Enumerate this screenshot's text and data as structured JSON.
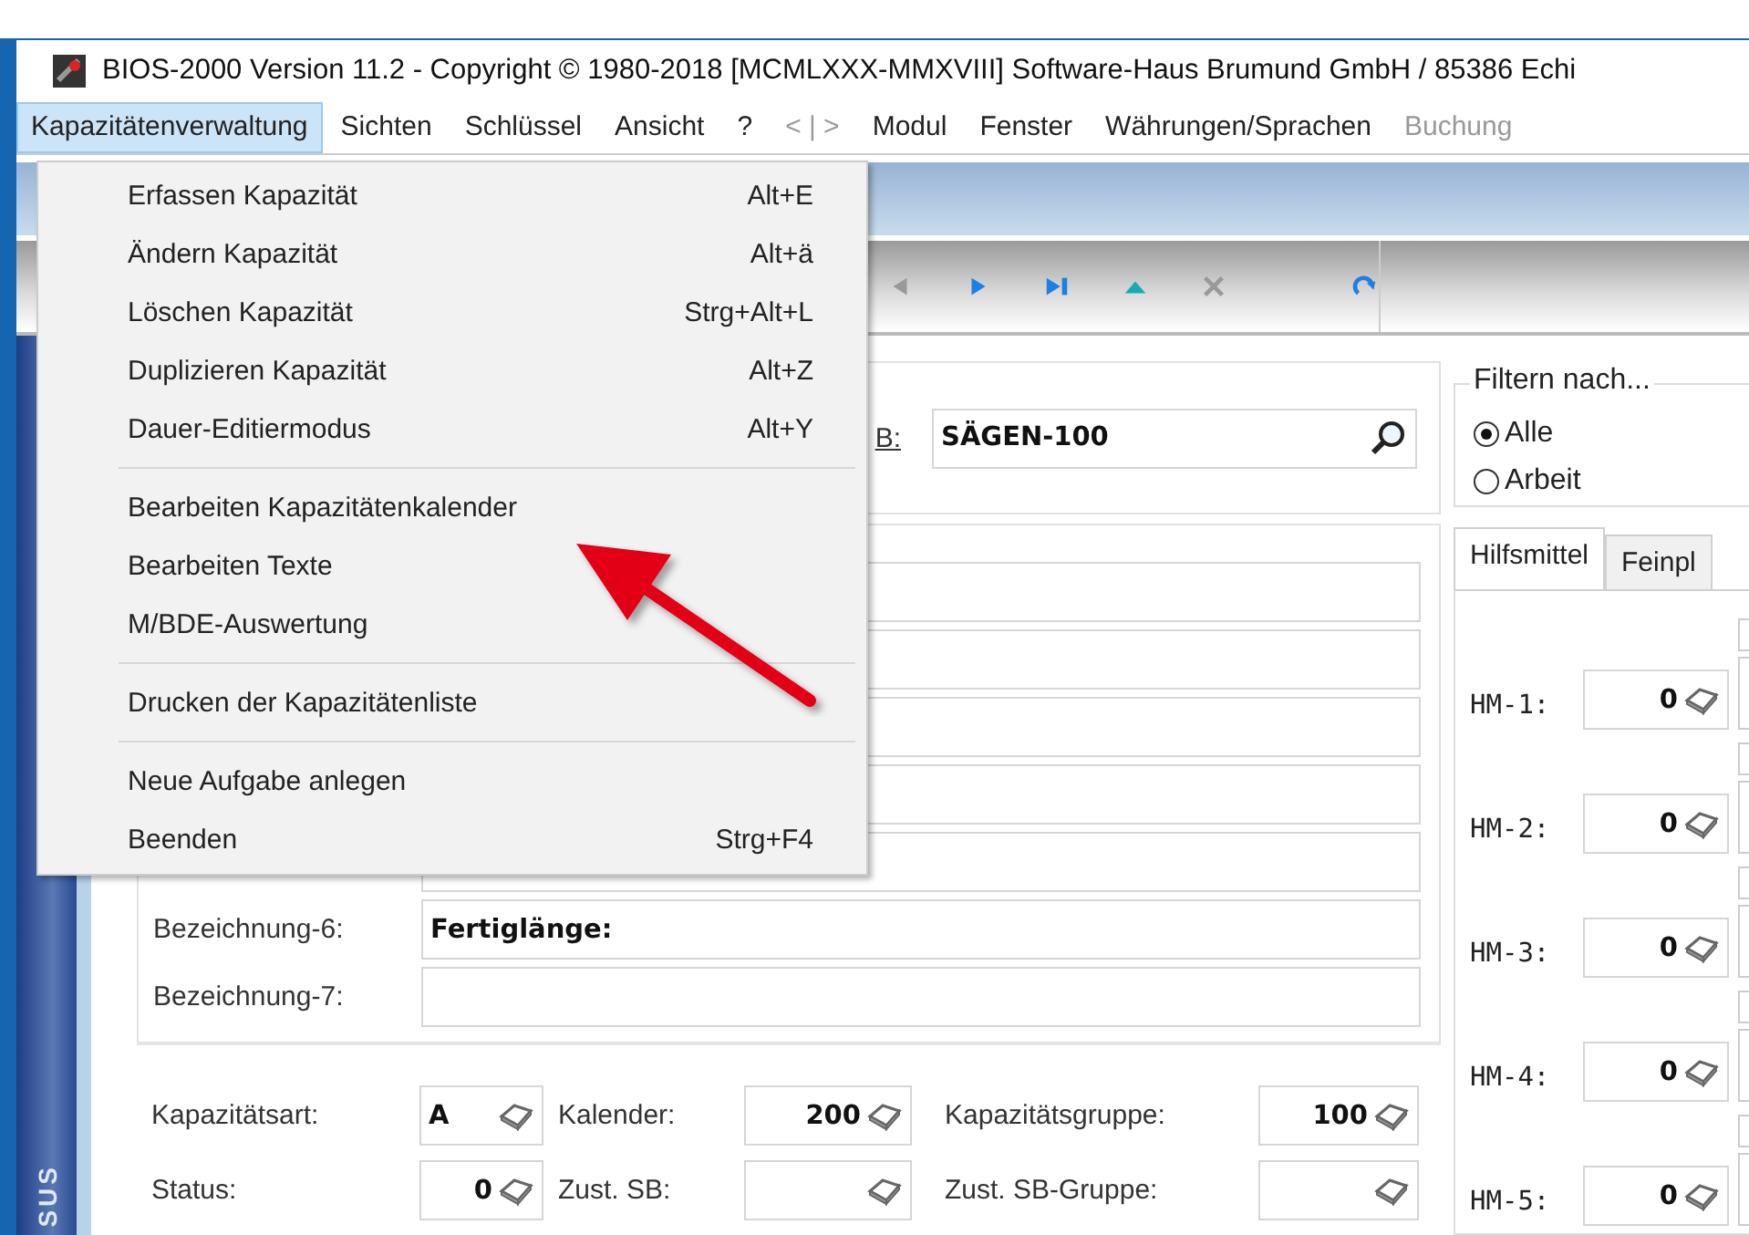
{
  "window": {
    "title": "BIOS-2000 Version 11.2  -  Copyright © 1980-2018 [MCMLXXX-MMXVIII] Software-Haus Brumund GmbH / 85386 Echi"
  },
  "menu_bar": [
    {
      "label": "Kapazitätenverwaltung",
      "selected": true,
      "disabled": false
    },
    {
      "label": "Sichten",
      "selected": false,
      "disabled": false
    },
    {
      "label": "Schlüssel",
      "selected": false,
      "disabled": false
    },
    {
      "label": "Ansicht",
      "selected": false,
      "disabled": false
    },
    {
      "label": "?",
      "selected": false,
      "disabled": false
    },
    {
      "label": "< | >",
      "selected": false,
      "disabled": true
    },
    {
      "label": "Modul",
      "selected": false,
      "disabled": false
    },
    {
      "label": "Fenster",
      "selected": false,
      "disabled": false
    },
    {
      "label": "Währungen/Sprachen",
      "selected": false,
      "disabled": false
    },
    {
      "label": "Buchung",
      "selected": false,
      "disabled": true
    }
  ],
  "menu": [
    {
      "kind": "item",
      "label": "Erfassen Kapazität",
      "shortcut": "Alt+E"
    },
    {
      "kind": "item",
      "label": "Ändern Kapazität",
      "shortcut": "Alt+ä"
    },
    {
      "kind": "item",
      "label": "Löschen Kapazität",
      "shortcut": "Strg+Alt+L"
    },
    {
      "kind": "item",
      "label": "Duplizieren Kapazität",
      "shortcut": "Alt+Z"
    },
    {
      "kind": "item",
      "label": "Dauer-Editiermodus",
      "shortcut": "Alt+Y"
    },
    {
      "kind": "separator"
    },
    {
      "kind": "item",
      "label": "Bearbeiten Kapazitätenkalender"
    },
    {
      "kind": "item",
      "label": "Bearbeiten Texte"
    },
    {
      "kind": "item",
      "label": "M/BDE-Auswertung"
    },
    {
      "kind": "separator"
    },
    {
      "kind": "item",
      "label": "Drucken der Kapazitätenliste"
    },
    {
      "kind": "separator"
    },
    {
      "kind": "item",
      "label": "Neue Aufgabe anlegen"
    },
    {
      "kind": "item",
      "label": "Beenden",
      "shortcut": "Strg+F4"
    }
  ],
  "toolbar": [
    {
      "kind": "previous",
      "disabled": true
    },
    {
      "kind": "next",
      "disabled": false
    },
    {
      "kind": "last",
      "disabled": false
    },
    {
      "kind": "up",
      "disabled": false
    },
    {
      "kind": "delete",
      "disabled": true
    },
    {
      "kind": "redo",
      "disabled": false
    }
  ],
  "nav": {
    "label": "SUS"
  },
  "search": {
    "label": "B:",
    "value": "SÄGEN-100"
  },
  "designations": [
    {
      "label": "Bezeichnung-6:",
      "value": "Fertiglänge:"
    },
    {
      "label": "Bezeichnung-7:"
    }
  ],
  "properties": [
    [
      {
        "label": "Kapazitätsart:",
        "value": "A",
        "left_aligned": true
      },
      {
        "label": "Kalender:",
        "value": "200"
      },
      {
        "label": "Kapazitätsgruppe:",
        "value": "100"
      }
    ],
    [
      {
        "label": "Status:",
        "value": "0"
      },
      {
        "label": "Zust. SB:"
      },
      {
        "label": "Zust. SB-Gruppe:"
      }
    ]
  ],
  "filter": {
    "title": "Filtern nach...",
    "options": [
      {
        "label": "Alle",
        "selected": true
      },
      {
        "label": "Arbeit",
        "selected": false
      }
    ]
  },
  "tabs": [
    {
      "label": "Hilfsmittel",
      "selected": true
    },
    {
      "label": "Feinpl",
      "selected": false
    }
  ],
  "tools": [
    {
      "label": "HM-1:",
      "value": "0"
    },
    {
      "label": "HM-2:",
      "value": "0"
    },
    {
      "label": "HM-3:",
      "value": "0"
    },
    {
      "label": "HM-4:",
      "value": "0"
    },
    {
      "label": "HM-5:",
      "value": "0"
    }
  ]
}
